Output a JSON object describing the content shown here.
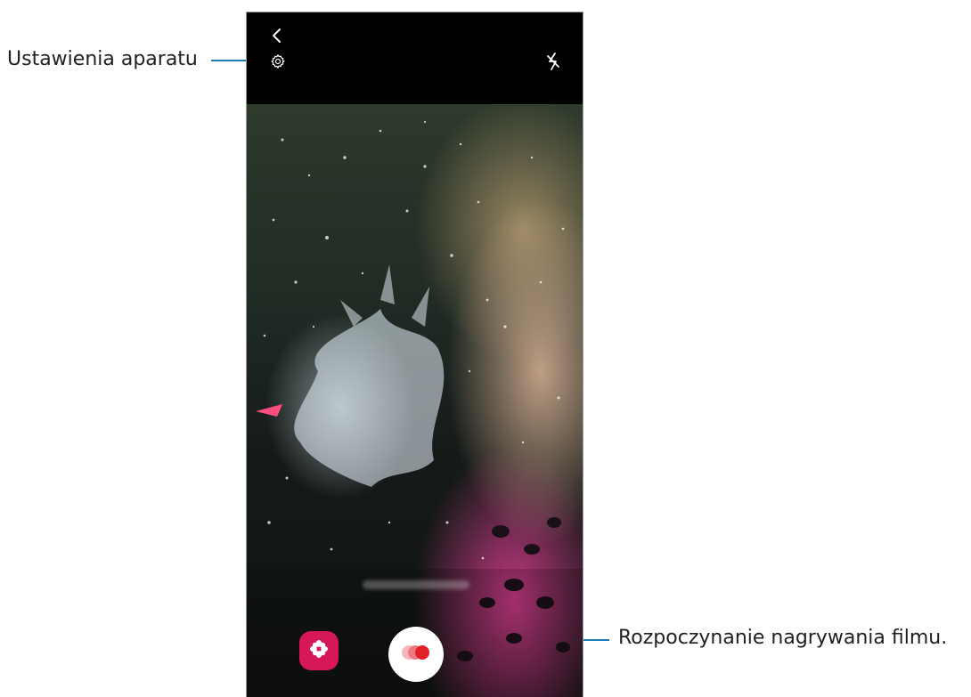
{
  "callouts": {
    "settings_label": "Ustawienia aparatu",
    "record_label": "Rozpoczynanie nagrywania filmu."
  },
  "icons": {
    "back": "back-icon",
    "settings": "gear-icon",
    "flash": "flash-off-icon",
    "gallery": "flower-icon",
    "record": "super-slow-mo-record-icon"
  },
  "colors": {
    "callout_line": "#1a7ab6",
    "gallery_accent": "#d6185a",
    "record_accent": "#e2202a"
  }
}
